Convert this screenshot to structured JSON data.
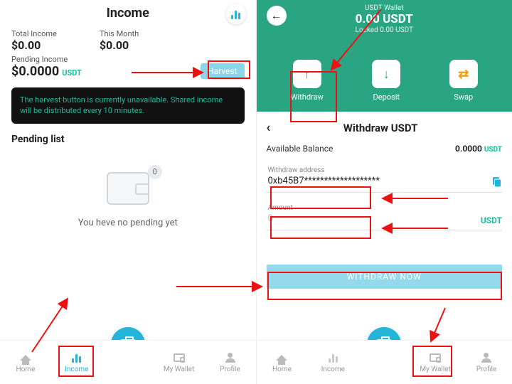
{
  "left": {
    "title": "Income",
    "total_label": "Total Income",
    "total_value": "$0.00",
    "month_label": "This Month",
    "month_value": "$0.00",
    "pending_label": "Pending Income",
    "pending_value": "$0.0000",
    "pending_unit": "USDT",
    "harvest_label": "Harvest",
    "notice": "The harvest button is currently unavailable. Shared income will be distributed every 10 minutes.",
    "pending_list_title": "Pending list",
    "badge": "0",
    "empty_text": "You heve no pending yet",
    "nav": {
      "home": "Home",
      "income": "Income",
      "wallet": "My Wallet",
      "profile": "Profile"
    }
  },
  "right": {
    "wallet_name": "USDT Wallet",
    "wallet_balance": "0.00 USDT",
    "wallet_locked": "Locked 0.00 USDT",
    "actions": {
      "withdraw": "Withdraw",
      "deposit": "Deposit",
      "swap": "Swap"
    },
    "section_title": "Withdraw USDT",
    "avail_label": "Available Balance",
    "avail_value": "0.0000",
    "avail_unit": "USDT",
    "addr_label": "Withdraw address",
    "addr_value": "0xb45B7*******************",
    "amount_label": "Amount",
    "amount_placeholder": "0",
    "amount_unit": "USDT",
    "button": "WITHDRAW NOW",
    "nav": {
      "home": "Home",
      "income": "Income",
      "wallet": "My Wallet",
      "profile": "Profile"
    }
  }
}
